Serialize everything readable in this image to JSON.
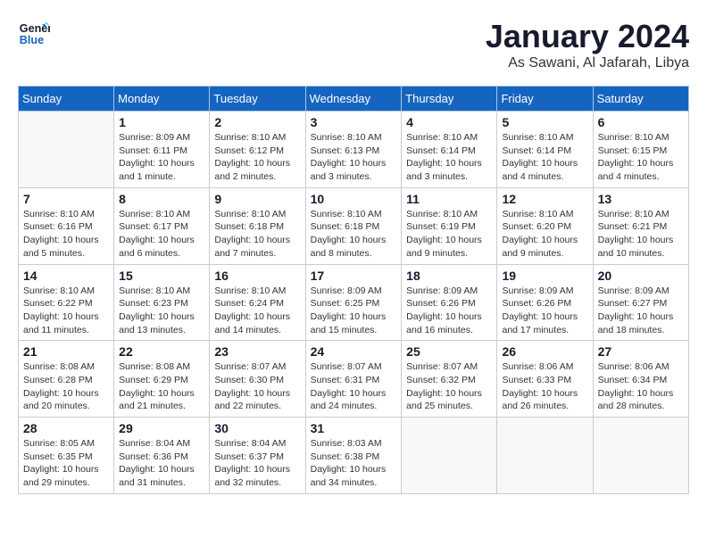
{
  "header": {
    "logo_line1": "General",
    "logo_line2": "Blue",
    "title": "January 2024",
    "location": "As Sawani, Al Jafarah, Libya"
  },
  "calendar": {
    "days_of_week": [
      "Sunday",
      "Monday",
      "Tuesday",
      "Wednesday",
      "Thursday",
      "Friday",
      "Saturday"
    ],
    "weeks": [
      [
        {
          "day": "",
          "info": ""
        },
        {
          "day": "1",
          "info": "Sunrise: 8:09 AM\nSunset: 6:11 PM\nDaylight: 10 hours\nand 1 minute."
        },
        {
          "day": "2",
          "info": "Sunrise: 8:10 AM\nSunset: 6:12 PM\nDaylight: 10 hours\nand 2 minutes."
        },
        {
          "day": "3",
          "info": "Sunrise: 8:10 AM\nSunset: 6:13 PM\nDaylight: 10 hours\nand 3 minutes."
        },
        {
          "day": "4",
          "info": "Sunrise: 8:10 AM\nSunset: 6:14 PM\nDaylight: 10 hours\nand 3 minutes."
        },
        {
          "day": "5",
          "info": "Sunrise: 8:10 AM\nSunset: 6:14 PM\nDaylight: 10 hours\nand 4 minutes."
        },
        {
          "day": "6",
          "info": "Sunrise: 8:10 AM\nSunset: 6:15 PM\nDaylight: 10 hours\nand 4 minutes."
        }
      ],
      [
        {
          "day": "7",
          "info": "Sunrise: 8:10 AM\nSunset: 6:16 PM\nDaylight: 10 hours\nand 5 minutes."
        },
        {
          "day": "8",
          "info": "Sunrise: 8:10 AM\nSunset: 6:17 PM\nDaylight: 10 hours\nand 6 minutes."
        },
        {
          "day": "9",
          "info": "Sunrise: 8:10 AM\nSunset: 6:18 PM\nDaylight: 10 hours\nand 7 minutes."
        },
        {
          "day": "10",
          "info": "Sunrise: 8:10 AM\nSunset: 6:18 PM\nDaylight: 10 hours\nand 8 minutes."
        },
        {
          "day": "11",
          "info": "Sunrise: 8:10 AM\nSunset: 6:19 PM\nDaylight: 10 hours\nand 9 minutes."
        },
        {
          "day": "12",
          "info": "Sunrise: 8:10 AM\nSunset: 6:20 PM\nDaylight: 10 hours\nand 9 minutes."
        },
        {
          "day": "13",
          "info": "Sunrise: 8:10 AM\nSunset: 6:21 PM\nDaylight: 10 hours\nand 10 minutes."
        }
      ],
      [
        {
          "day": "14",
          "info": "Sunrise: 8:10 AM\nSunset: 6:22 PM\nDaylight: 10 hours\nand 11 minutes."
        },
        {
          "day": "15",
          "info": "Sunrise: 8:10 AM\nSunset: 6:23 PM\nDaylight: 10 hours\nand 13 minutes."
        },
        {
          "day": "16",
          "info": "Sunrise: 8:10 AM\nSunset: 6:24 PM\nDaylight: 10 hours\nand 14 minutes."
        },
        {
          "day": "17",
          "info": "Sunrise: 8:09 AM\nSunset: 6:25 PM\nDaylight: 10 hours\nand 15 minutes."
        },
        {
          "day": "18",
          "info": "Sunrise: 8:09 AM\nSunset: 6:26 PM\nDaylight: 10 hours\nand 16 minutes."
        },
        {
          "day": "19",
          "info": "Sunrise: 8:09 AM\nSunset: 6:26 PM\nDaylight: 10 hours\nand 17 minutes."
        },
        {
          "day": "20",
          "info": "Sunrise: 8:09 AM\nSunset: 6:27 PM\nDaylight: 10 hours\nand 18 minutes."
        }
      ],
      [
        {
          "day": "21",
          "info": "Sunrise: 8:08 AM\nSunset: 6:28 PM\nDaylight: 10 hours\nand 20 minutes."
        },
        {
          "day": "22",
          "info": "Sunrise: 8:08 AM\nSunset: 6:29 PM\nDaylight: 10 hours\nand 21 minutes."
        },
        {
          "day": "23",
          "info": "Sunrise: 8:07 AM\nSunset: 6:30 PM\nDaylight: 10 hours\nand 22 minutes."
        },
        {
          "day": "24",
          "info": "Sunrise: 8:07 AM\nSunset: 6:31 PM\nDaylight: 10 hours\nand 24 minutes."
        },
        {
          "day": "25",
          "info": "Sunrise: 8:07 AM\nSunset: 6:32 PM\nDaylight: 10 hours\nand 25 minutes."
        },
        {
          "day": "26",
          "info": "Sunrise: 8:06 AM\nSunset: 6:33 PM\nDaylight: 10 hours\nand 26 minutes."
        },
        {
          "day": "27",
          "info": "Sunrise: 8:06 AM\nSunset: 6:34 PM\nDaylight: 10 hours\nand 28 minutes."
        }
      ],
      [
        {
          "day": "28",
          "info": "Sunrise: 8:05 AM\nSunset: 6:35 PM\nDaylight: 10 hours\nand 29 minutes."
        },
        {
          "day": "29",
          "info": "Sunrise: 8:04 AM\nSunset: 6:36 PM\nDaylight: 10 hours\nand 31 minutes."
        },
        {
          "day": "30",
          "info": "Sunrise: 8:04 AM\nSunset: 6:37 PM\nDaylight: 10 hours\nand 32 minutes."
        },
        {
          "day": "31",
          "info": "Sunrise: 8:03 AM\nSunset: 6:38 PM\nDaylight: 10 hours\nand 34 minutes."
        },
        {
          "day": "",
          "info": ""
        },
        {
          "day": "",
          "info": ""
        },
        {
          "day": "",
          "info": ""
        }
      ]
    ]
  }
}
